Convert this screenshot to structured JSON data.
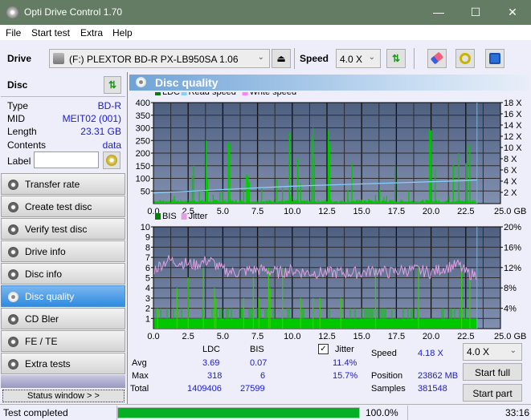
{
  "window": {
    "title": "Opti Drive Control 1.70",
    "minimize": "—",
    "maximize": "☐",
    "close": "✕"
  },
  "menu": [
    {
      "label": "File"
    },
    {
      "label": "Start test"
    },
    {
      "label": "Extra"
    },
    {
      "label": "Help"
    }
  ],
  "toolbar": {
    "drive_label": "Drive",
    "drive_value": "(F:)  PLEXTOR BD-R  PX-LB950SA 1.06",
    "speed_label": "Speed",
    "speed_value": "4.0 X"
  },
  "disc": {
    "header": "Disc",
    "rows": [
      {
        "key": "Type",
        "value": "BD-R"
      },
      {
        "key": "MID",
        "value": "MEIT02 (001)"
      },
      {
        "key": "Length",
        "value": "23.31 GB"
      },
      {
        "key": "Contents",
        "value": "data"
      }
    ],
    "label_key": "Label",
    "label_value": ""
  },
  "nav": [
    {
      "label": "Transfer rate",
      "active": false
    },
    {
      "label": "Create test disc",
      "active": false
    },
    {
      "label": "Verify test disc",
      "active": false
    },
    {
      "label": "Drive info",
      "active": false
    },
    {
      "label": "Disc info",
      "active": false
    },
    {
      "label": "Disc quality",
      "active": true
    },
    {
      "label": "CD Bler",
      "active": false
    },
    {
      "label": "FE / TE",
      "active": false
    },
    {
      "label": "Extra tests",
      "active": false
    }
  ],
  "status_window_button": "Status window > >",
  "main": {
    "title": "Disc quality"
  },
  "chart_data": [
    {
      "type": "bar",
      "title": "LDC / Read speed",
      "legend": [
        {
          "name": "LDC",
          "color": "#008000"
        },
        {
          "name": "Read speed",
          "color": "#87cefa"
        },
        {
          "name": "Write speed",
          "color": "#ff80ff"
        }
      ],
      "x_range": [
        0,
        25
      ],
      "x_ticks": [
        "0.0",
        "2.5",
        "5.0",
        "7.5",
        "10.0",
        "12.5",
        "15.0",
        "17.5",
        "20.0",
        "22.5",
        "25.0 GB"
      ],
      "y_range": [
        0,
        400
      ],
      "y_ticks": [
        "50",
        "100",
        "150",
        "200",
        "250",
        "300",
        "350",
        "400"
      ],
      "y2_range": [
        0,
        18
      ],
      "y2_ticks": [
        "2 X",
        "4 X",
        "6 X",
        "8 X",
        "10 X",
        "12 X",
        "14 X",
        "16 X",
        "18 X"
      ],
      "end_position_gb": 23.31,
      "ldc_spikes": [
        [
          0.5,
          15
        ],
        [
          1.5,
          30
        ],
        [
          2.8,
          110
        ],
        [
          2.9,
          150
        ],
        [
          3.3,
          55
        ],
        [
          3.8,
          250
        ],
        [
          3.9,
          100
        ],
        [
          4.3,
          35
        ],
        [
          4.8,
          45
        ],
        [
          5.0,
          50
        ],
        [
          5.4,
          245
        ],
        [
          5.5,
          235
        ],
        [
          6.5,
          55
        ],
        [
          6.7,
          115
        ],
        [
          6.8,
          110
        ],
        [
          6.9,
          85
        ],
        [
          7.8,
          65
        ],
        [
          8.9,
          95
        ],
        [
          9.3,
          65
        ],
        [
          9.8,
          280
        ],
        [
          9.9,
          35
        ],
        [
          10.4,
          180
        ],
        [
          10.6,
          80
        ],
        [
          11.4,
          265
        ],
        [
          11.5,
          300
        ],
        [
          11.6,
          180
        ],
        [
          12.6,
          290
        ],
        [
          12.7,
          240
        ],
        [
          13.2,
          10
        ],
        [
          14.0,
          55
        ],
        [
          14.3,
          160
        ],
        [
          15.0,
          15
        ],
        [
          15.5,
          20
        ],
        [
          16.0,
          35
        ],
        [
          16.3,
          55
        ],
        [
          16.6,
          25
        ],
        [
          16.8,
          30
        ],
        [
          17.4,
          145
        ],
        [
          18.4,
          50
        ],
        [
          19.9,
          295
        ],
        [
          20.0,
          290
        ],
        [
          20.3,
          140
        ],
        [
          21.3,
          30
        ],
        [
          21.6,
          155
        ],
        [
          22.0,
          200
        ],
        [
          22.5,
          160
        ],
        [
          22.6,
          235
        ],
        [
          22.8,
          230
        ]
      ],
      "read_speed_x": [
        [
          0.0,
          1.9
        ],
        [
          2.5,
          2.2
        ],
        [
          5.0,
          2.5
        ],
        [
          7.5,
          2.8
        ],
        [
          10.0,
          3.1
        ],
        [
          12.5,
          3.3
        ],
        [
          15.0,
          3.5
        ],
        [
          17.5,
          3.7
        ],
        [
          20.0,
          3.9
        ],
        [
          22.5,
          4.1
        ],
        [
          23.31,
          4.2
        ]
      ]
    },
    {
      "type": "bar",
      "title": "BIS / Jitter",
      "legend": [
        {
          "name": "BIS",
          "color": "#008000"
        },
        {
          "name": "Jitter",
          "color": "#e0a0e0"
        }
      ],
      "x_range": [
        0,
        25
      ],
      "x_ticks": [
        "0.0",
        "2.5",
        "5.0",
        "7.5",
        "10.0",
        "12.5",
        "15.0",
        "17.5",
        "20.0",
        "22.5",
        "25.0 GB"
      ],
      "y_range": [
        0,
        10
      ],
      "y_ticks": [
        "1",
        "2",
        "3",
        "4",
        "5",
        "6",
        "7",
        "8",
        "9",
        "10"
      ],
      "y2_range": [
        0,
        20
      ],
      "y2_ticks": [
        "4%",
        "8%",
        "12%",
        "16%",
        "20%"
      ],
      "end_position_gb": 23.31,
      "bis_base": 1,
      "bis_spikes": [
        [
          0.3,
          2
        ],
        [
          1.7,
          4
        ],
        [
          2.5,
          5
        ],
        [
          3.6,
          6
        ],
        [
          4.4,
          4
        ],
        [
          4.5,
          3
        ],
        [
          6.5,
          3
        ],
        [
          7.2,
          5
        ],
        [
          7.6,
          3
        ],
        [
          8.3,
          6
        ],
        [
          8.4,
          4
        ],
        [
          9.3,
          6
        ],
        [
          10.6,
          3
        ],
        [
          11.5,
          3
        ],
        [
          12.0,
          3
        ],
        [
          13.5,
          3
        ],
        [
          16.0,
          6
        ],
        [
          19.1,
          6
        ],
        [
          22.2,
          6
        ],
        [
          22.8,
          5
        ]
      ],
      "jitter_pct": [
        [
          0.0,
          11.5
        ],
        [
          1.0,
          13.5
        ],
        [
          2.0,
          13.0
        ],
        [
          3.0,
          12.5
        ],
        [
          4.0,
          13.5
        ],
        [
          5.0,
          11.5
        ],
        [
          6.0,
          11.0
        ],
        [
          7.0,
          11.5
        ],
        [
          8.0,
          11.5
        ],
        [
          9.0,
          11.0
        ],
        [
          10.0,
          11.5
        ],
        [
          11.0,
          11.0
        ],
        [
          12.0,
          11.0
        ],
        [
          13.0,
          11.0
        ],
        [
          14.0,
          11.0
        ],
        [
          15.0,
          11.0
        ],
        [
          16.0,
          11.5
        ],
        [
          17.0,
          11.0
        ],
        [
          18.0,
          11.5
        ],
        [
          19.0,
          11.5
        ],
        [
          20.0,
          11.0
        ],
        [
          21.0,
          12.0
        ],
        [
          22.0,
          12.5
        ],
        [
          22.5,
          11.0
        ],
        [
          23.3,
          10.5
        ]
      ]
    }
  ],
  "stats": {
    "col_ldc": "LDC",
    "col_bis": "BIS",
    "jitter_label": "Jitter",
    "jitter_checked": true,
    "rows": [
      {
        "label": "Avg",
        "ldc": "3.69",
        "bis": "0.07",
        "jitter": "11.4%"
      },
      {
        "label": "Max",
        "ldc": "318",
        "bis": "6",
        "jitter": "15.7%"
      },
      {
        "label": "Total",
        "ldc": "1409406",
        "bis": "27599",
        "jitter": ""
      }
    ],
    "speed_label": "Speed",
    "speed_value": "4.18 X",
    "position_label": "Position",
    "position_value": "23862 MB",
    "samples_label": "Samples",
    "samples_value": "381548",
    "speed_select": "4.0 X",
    "start_full": "Start full",
    "start_part": "Start part"
  },
  "status": {
    "text": "Test completed",
    "progress": 100.0,
    "progress_text": "100.0%",
    "time": "33:16"
  }
}
